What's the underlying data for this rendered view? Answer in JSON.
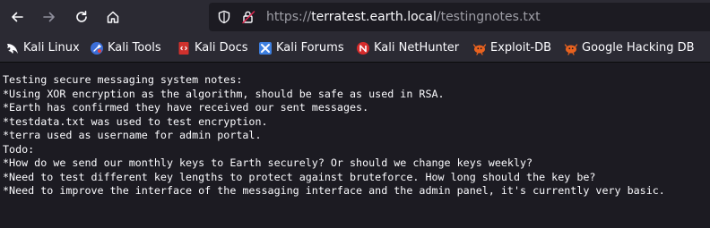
{
  "toolbar": {
    "back": "back-arrow-icon",
    "forward": "forward-arrow-icon",
    "reload": "reload-icon",
    "home": "home-icon"
  },
  "address": {
    "prefix": "https://",
    "host": "terratest.earth.local",
    "path": "/testingnotes.txt"
  },
  "bookmarks": [
    {
      "label": "Kali Linux",
      "icon": "kali-dragon-icon"
    },
    {
      "label": "Kali Tools",
      "icon": "kali-tools-icon"
    },
    {
      "label": "Kali Docs",
      "icon": "kali-docs-icon"
    },
    {
      "label": "Kali Forums",
      "icon": "kali-forums-icon"
    },
    {
      "label": "Kali NetHunter",
      "icon": "nethunter-icon"
    },
    {
      "label": "Exploit-DB",
      "icon": "exploit-db-icon"
    },
    {
      "label": "Google Hacking DB",
      "icon": "ghdb-icon"
    }
  ],
  "document": {
    "lines": [
      "Testing secure messaging system notes:",
      "*Using XOR encryption as the algorithm, should be safe as used in RSA.",
      "*Earth has confirmed they have received our sent messages.",
      "*testdata.txt was used to test encryption.",
      "*terra used as username for admin portal.",
      "Todo:",
      "*How do we send our monthly keys to Earth securely? Or should we change keys weekly?",
      "*Need to test different key lengths to protect against bruteforce. How long should the key be?",
      "*Need to improve the interface of the messaging interface and the admin panel, it's currently very basic."
    ]
  },
  "colors": {
    "page_bg": "#1c1b22",
    "chrome_bg": "#2b2a33",
    "text": "#fbfbfe",
    "url_dim": "#9e9ea6"
  }
}
